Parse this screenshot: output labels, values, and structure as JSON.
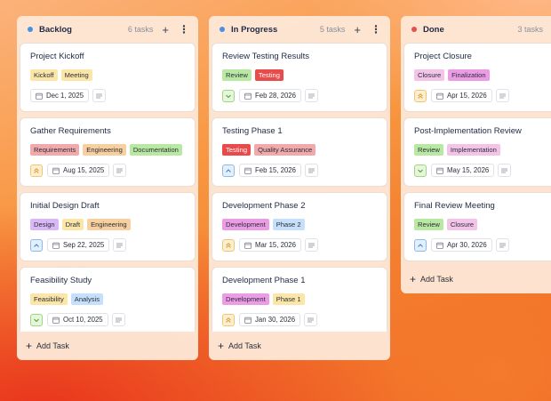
{
  "colors": {
    "backlog_dot": "#4a90e2",
    "progress_dot": "#4a90e2",
    "done_dot": "#e2524a",
    "tag_pink": "#f3c4d2",
    "tag_yellow": "#fbe6a8",
    "tag_red": "#e94b4b",
    "tag_rose": "#f1a9ab",
    "tag_orange": "#f8cf9e",
    "tag_green": "#b9e8a2",
    "tag_purple": "#d9b8f5",
    "tag_blue": "#c6e0fb",
    "tag_magenta": "#ec9ce4"
  },
  "columns": [
    {
      "title": "Backlog",
      "count": "6 tasks",
      "add_label": "Add Task",
      "cards": [
        {
          "title": "Project Kickoff",
          "tags": [
            "Kickoff",
            "Meeting"
          ],
          "priority": "none",
          "date": "Dec 1, 2025"
        },
        {
          "title": "Gather Requirements",
          "tags": [
            "Requirements",
            "Engineering",
            "Documentation"
          ],
          "priority": "high",
          "date": "Aug 15, 2025"
        },
        {
          "title": "Initial Design Draft",
          "tags": [
            "Design",
            "Draft",
            "Engineering"
          ],
          "priority": "medium",
          "date": "Sep 22, 2025"
        },
        {
          "title": "Feasibility Study",
          "tags": [
            "Feasibility",
            "Analysis"
          ],
          "priority": "low",
          "date": "Oct 10, 2025"
        }
      ]
    },
    {
      "title": "In Progress",
      "count": "5 tasks",
      "add_label": "Add Task",
      "cards": [
        {
          "title": "Review Testing Results",
          "tags": [
            "Review",
            "Testing"
          ],
          "priority": "low",
          "date": "Feb 28, 2026"
        },
        {
          "title": "Testing Phase 1",
          "tags": [
            "Testing",
            "Quality Assurance"
          ],
          "priority": "medium",
          "date": "Feb 15, 2026"
        },
        {
          "title": "Development Phase 2",
          "tags": [
            "Development",
            "Phase 2"
          ],
          "priority": "high",
          "date": "Mar 15, 2026"
        },
        {
          "title": "Development Phase 1",
          "tags": [
            "Development",
            "Phase 1"
          ],
          "priority": "high",
          "date": "Jan 30, 2026"
        }
      ]
    },
    {
      "title": "Done",
      "count": "3 tasks",
      "add_label": "Add Task",
      "cards": [
        {
          "title": "Project Closure",
          "tags": [
            "Closure",
            "Finalization"
          ],
          "priority": "high",
          "date": "Apr 15, 2026"
        },
        {
          "title": "Post-Implementation Review",
          "tags": [
            "Review",
            "Implementation"
          ],
          "priority": "low",
          "date": "May 15, 2026"
        },
        {
          "title": "Final Review Meeting",
          "tags": [
            "Review",
            "Closure"
          ],
          "priority": "medium",
          "date": "Apr 30, 2026"
        }
      ]
    }
  ]
}
